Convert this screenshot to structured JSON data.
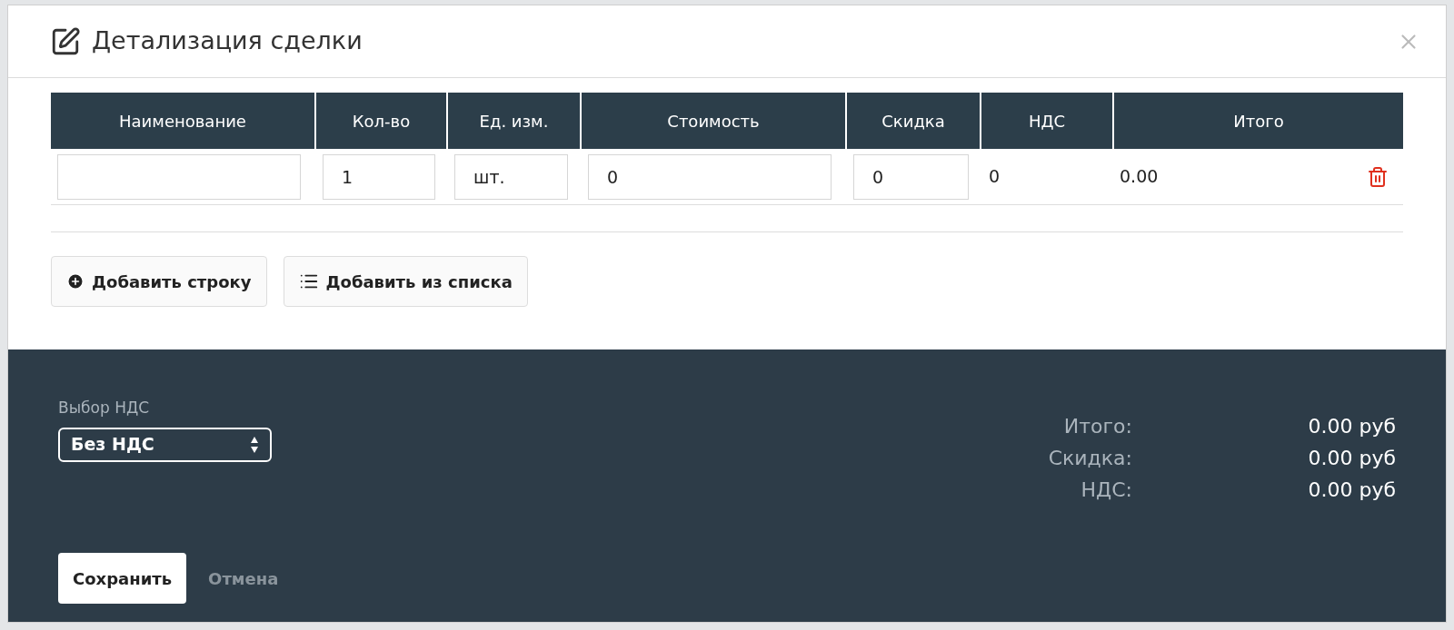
{
  "dialog": {
    "title": "Детализация сделки"
  },
  "table": {
    "columns": [
      "Наименование",
      "Кол-во",
      "Ед. изм.",
      "Стоимость",
      "Скидка",
      "НДС",
      "Итого"
    ],
    "rows": [
      {
        "quantity": "1",
        "unit": "шт.",
        "cost": "0",
        "discount": "0",
        "vat": "0",
        "total": "0.00"
      }
    ]
  },
  "actions": [
    "Добавить строку",
    "Добавить из списка"
  ],
  "vat_select": {
    "label": "Выбор НДС",
    "value": "Без НДС"
  },
  "summary": [
    {
      "label": "Итого:",
      "value": "0.00 руб"
    },
    {
      "label": "Скидка:",
      "value": "0.00 руб"
    },
    {
      "label": "НДС:",
      "value": "0.00 руб"
    }
  ],
  "footer_buttons": [
    {
      "label": "Сохранить",
      "kind": "primary"
    },
    {
      "label": "Отмена",
      "kind": "link"
    }
  ]
}
